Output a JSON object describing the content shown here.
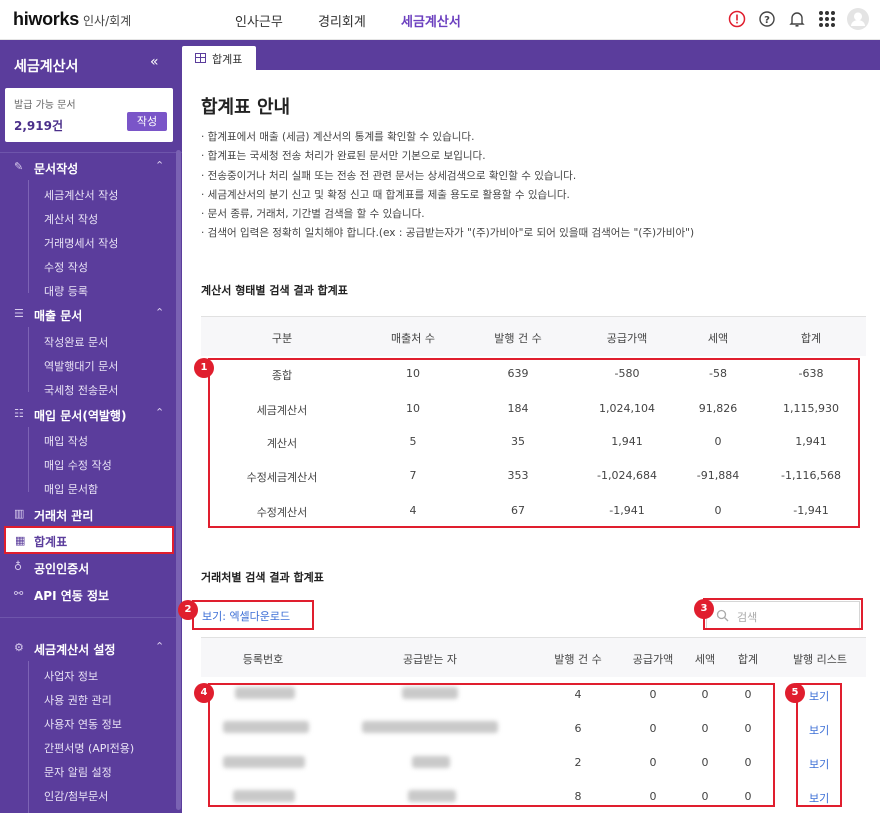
{
  "header": {
    "logo": "hiworks",
    "logo_sub": "인사/회계",
    "nav": [
      "인사근무",
      "경리회계",
      "세금계산서"
    ],
    "active_nav": "세금계산서"
  },
  "sidebar": {
    "title": "세금계산서",
    "available_label": "발급 가능 문서",
    "available_count": "2,919건",
    "write_button": "작성",
    "sections": [
      {
        "label": "문서작성",
        "items": [
          "세금계산서 작성",
          "계산서 작성",
          "거래명세서 작성",
          "수정 작성",
          "대량 등록"
        ]
      },
      {
        "label": "매출 문서",
        "items": [
          "작성완료 문서",
          "역발행대기 문서",
          "국세청 전송문서"
        ]
      },
      {
        "label": "매입 문서(역발행)",
        "items": [
          "매입 작성",
          "매입 수정 작성",
          "매입 문서함"
        ]
      }
    ],
    "links": [
      "거래처 관리",
      "합계표",
      "공인인증서",
      "API 연동 정보"
    ],
    "active_link": "합계표",
    "settings": {
      "label": "세금계산서 설정",
      "items": [
        "사업자 정보",
        "사용 권한 관리",
        "사용자 연동 정보",
        "간편서명 (API전용)",
        "문자 알림 설정",
        "인감/첨부문서"
      ]
    }
  },
  "tab": {
    "label": "합계표"
  },
  "main": {
    "title": "합계표 안내",
    "notes": [
      "· 합계표에서 매출 (세금) 계산서의 통계를 확인할 수 있습니다.",
      "· 합계표는 국세청 전송 처리가 완료된 문서만 기본으로 보입니다.",
      "· 전송중이거나 처리 실패 또는 전송 전 관련 문서는 상세검색으로 확인할 수 있습니다.",
      "· 세금계산서의 분기 신고 및 확정 신고 때 합계표를 제출 용도로 활용할 수 있습니다.",
      "· 문서 종류, 거래처, 기간별 검색을 할 수 있습니다.",
      "· 검색어 입력은 정확히 일치해야 합니다.(ex : 공급받는자가 \"(주)가비아\"로 되어 있을때 검색어는 \"(주)가비아\")"
    ],
    "table1": {
      "title": "계산서 형태별 검색 결과 합계표",
      "headers": [
        "구분",
        "매출처 수",
        "발행 건 수",
        "공급가액",
        "세액",
        "합계"
      ],
      "rows": [
        [
          "종합",
          "10",
          "639",
          "-580",
          "-58",
          "-638"
        ],
        [
          "세금계산서",
          "10",
          "184",
          "1,024,104",
          "91,826",
          "1,115,930"
        ],
        [
          "계산서",
          "5",
          "35",
          "1,941",
          "0",
          "1,941"
        ],
        [
          "수정세금계산서",
          "7",
          "353",
          "-1,024,684",
          "-91,884",
          "-1,116,568"
        ],
        [
          "수정계산서",
          "4",
          "67",
          "-1,941",
          "0",
          "-1,941"
        ]
      ]
    },
    "table2": {
      "title": "거래처별 검색 결과 합계표",
      "excel_link": "보기: 엑셀다운로드",
      "search_placeholder": "검색",
      "headers": [
        "등록번호",
        "공급받는 자",
        "발행 건 수",
        "공급가액",
        "세액",
        "합계",
        "발행 리스트"
      ],
      "rows": [
        {
          "count": "4",
          "supply": "0",
          "tax": "0",
          "total": "0",
          "view": "보기"
        },
        {
          "count": "6",
          "supply": "0",
          "tax": "0",
          "total": "0",
          "view": "보기"
        },
        {
          "count": "2",
          "supply": "0",
          "tax": "0",
          "total": "0",
          "view": "보기"
        },
        {
          "count": "8",
          "supply": "0",
          "tax": "0",
          "total": "0",
          "view": "보기"
        }
      ]
    }
  },
  "badges": [
    "1",
    "2",
    "3",
    "4",
    "5"
  ],
  "colors": {
    "brand": "#5b3d9c",
    "highlight": "#e01e2e",
    "link": "#3d6fd6"
  }
}
